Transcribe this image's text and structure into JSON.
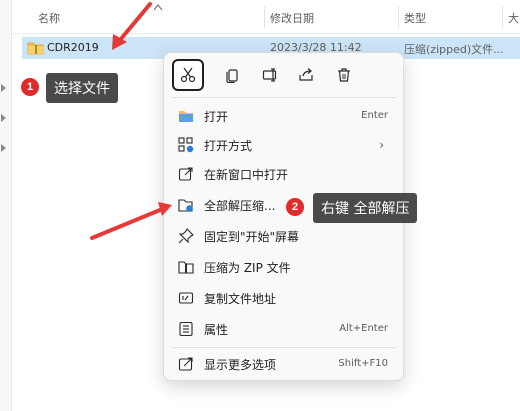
{
  "columns": {
    "name": "名称",
    "modified": "修改日期",
    "type": "类型",
    "size": "大"
  },
  "file": {
    "name": "CDR2019",
    "modified": "2023/3/28 11:42",
    "type": "压缩(zipped)文件..."
  },
  "menu": {
    "top_buttons": [
      "cut-icon",
      "copy-icon",
      "rename-icon",
      "share-icon",
      "delete-icon"
    ],
    "items": [
      {
        "label": "打开",
        "shortcut": "Enter",
        "icon": "folder-open-icon"
      },
      {
        "label": "打开方式",
        "shortcut": "",
        "icon": "open-with-icon",
        "submenu": "›"
      },
      {
        "label": "在新窗口中打开",
        "shortcut": "",
        "icon": "new-window-icon"
      },
      {
        "label": "全部解压缩...",
        "shortcut": "",
        "icon": "extract-all-icon"
      },
      {
        "label": "固定到\"开始\"屏幕",
        "shortcut": "",
        "icon": "pin-icon"
      },
      {
        "label": "压缩为 ZIP 文件",
        "shortcut": "",
        "icon": "zip-icon"
      },
      {
        "label": "复制文件地址",
        "shortcut": "",
        "icon": "copy-path-icon"
      },
      {
        "label": "属性",
        "shortcut": "Alt+Enter",
        "icon": "properties-icon"
      },
      {
        "label": "显示更多选项",
        "shortcut": "Shift+F10",
        "icon": "more-options-icon"
      }
    ]
  },
  "annotations": {
    "step1": {
      "num": "1",
      "text": "选择文件"
    },
    "step2": {
      "num": "2",
      "text": "右键 全部解压"
    }
  },
  "colors": {
    "selection": "#cce4f7",
    "badge": "#e02b2b",
    "callout": "#4a4a4a",
    "arrow": "#e53935"
  }
}
